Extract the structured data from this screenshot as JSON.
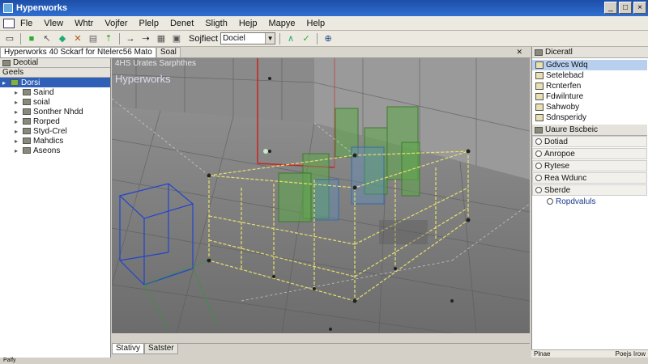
{
  "window": {
    "title": "Hyperworks"
  },
  "menu": [
    "Fle",
    "Vlew",
    "Whtr",
    "Vojfer",
    "Plelp",
    "Denet",
    "Sligth",
    "Hejp",
    "Mapye",
    "Help"
  ],
  "toolbar": {
    "label": "Sojfiect",
    "dropdown": "Dociel"
  },
  "doc_tab": {
    "title": "Hyperworks 40 Sckarf for Ntelerc56 Mato",
    "second": "Soal"
  },
  "left_panel": {
    "header": "Deotial",
    "header2": "Geels",
    "selected": "Dorsi",
    "items": [
      "Saind",
      "soial",
      "Sonther Nhdd",
      "Rorped",
      "Styd-Crel",
      "Mahdics",
      "Aseons"
    ]
  },
  "viewport": {
    "info": "4HS Urates Sarphthes",
    "logo": "Hyperworks",
    "tabs": [
      "Stativy",
      "Satster"
    ]
  },
  "right_panel": {
    "header": "Diceratl",
    "items": [
      "Gdvcs Wdq",
      "Setelebacl",
      "Rcnterfen",
      "Fdwilnture",
      "Sahwoby",
      "Sdnsperidy"
    ],
    "section": "Uaure Bscbeic",
    "props": [
      "Dotiad",
      "Anropoe",
      "Rytese",
      "Rea Wdunc",
      "Sberde"
    ],
    "sub": "Ropdvaluls",
    "footer_left": "Plnae",
    "footer_right": "Poejs Irow"
  },
  "status": {
    "left": "Palfy"
  },
  "colors": {
    "title_bar": "#1d4ea8",
    "selection": "#2f5fb6",
    "box_green": "#5fa84a",
    "wire_yellow": "#e8e070",
    "wire_blue": "#2244cc",
    "axis_red": "#cc2222"
  }
}
